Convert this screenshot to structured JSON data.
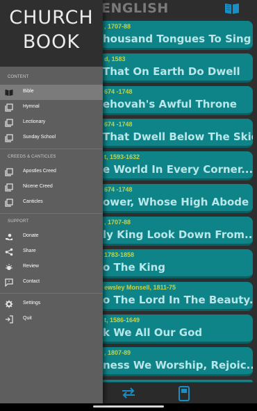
{
  "header": {
    "title": "ENGLISH",
    "book_icon": "book-open-icon"
  },
  "hymns": [
    {
      "meta": ", 1707-88",
      "title": "housand Tongues To Sing"
    },
    {
      "meta": "d, 1583",
      "title": "That On Earth Do Dwell"
    },
    {
      "meta": "674 -1748",
      "title": "ehovah's Awful Throne"
    },
    {
      "meta": "674 -1748",
      "title": "That Dwell Below The Skies"
    },
    {
      "meta": "t, 1593-1632",
      "title": "e World In Every Corner..."
    },
    {
      "meta": "674 -1748",
      "title": "ower, Whose High Abode"
    },
    {
      "meta": ", 1707-88",
      "title": "ly King Look Down From..."
    },
    {
      "meta": "1783-1858",
      "title": "o The King"
    },
    {
      "meta": "ewsley Monsell, 1811-75",
      "title": "o The Lord In The Beauty..."
    },
    {
      "meta": "t, 1586-1649",
      "title": "k We All Our God"
    },
    {
      "meta": ", 1807-89",
      "title": "ness We Worship, Rejoic..."
    }
  ],
  "bottom_bar": {
    "swap_icon": "swap-arrows-icon",
    "book_icon": "book-icon"
  },
  "drawer": {
    "logo_line1": "CHURCH",
    "logo_line2": "BOOK",
    "sections": {
      "content": "CONTENT",
      "creeds": "CREEDS & CANTICLES",
      "support": "SUPPORT"
    },
    "items": {
      "bible": "Bible",
      "hymnal": "Hymnal",
      "lectionary": "Lectionary",
      "sunday_school": "Sunday School",
      "apostles_creed": "Apostles Creed",
      "nicene_creed": "Nicene Creed",
      "canticles": "Canticles",
      "donate": "Donate",
      "share": "Share",
      "review": "Review",
      "contact": "Contact",
      "settings": "Settings",
      "quit": "Quit"
    },
    "active_item": "Bible"
  },
  "colors": {
    "card": "#0e8489",
    "card_meta": "#c5d34a",
    "card_title": "#b9e6e8",
    "drawer": "#5e5e5e",
    "drawer_header": "#2f2f2f",
    "active_item": "#7b7b7b"
  }
}
